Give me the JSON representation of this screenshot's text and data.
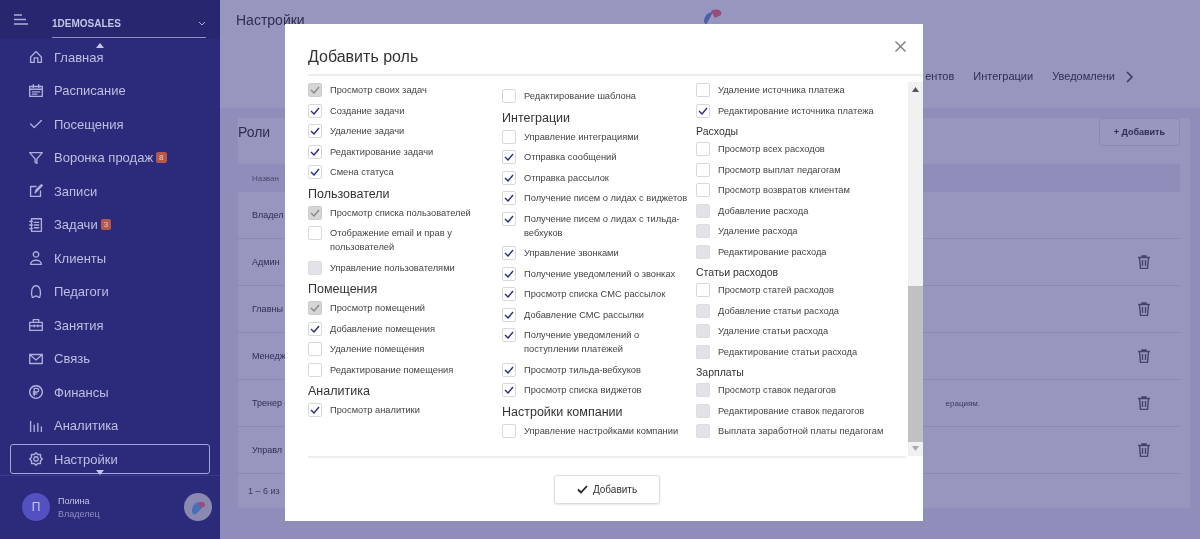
{
  "sidebar": {
    "company": "1DEMOSALES",
    "items": [
      {
        "label": "Главная",
        "selected": false
      },
      {
        "label": "Расписание",
        "selected": false
      },
      {
        "label": "Посещения",
        "selected": false
      },
      {
        "label": "Воронка продаж",
        "selected": false,
        "badge": "8"
      },
      {
        "label": "Записи",
        "selected": false
      },
      {
        "label": "Задачи",
        "selected": false,
        "badge": "3"
      },
      {
        "label": "Клиенты",
        "selected": false
      },
      {
        "label": "Педагоги",
        "selected": false
      },
      {
        "label": "Занятия",
        "selected": false
      },
      {
        "label": "Связь",
        "selected": false
      },
      {
        "label": "Финансы",
        "selected": false
      },
      {
        "label": "Аналитика",
        "selected": false
      },
      {
        "label": "Настройки",
        "selected": true
      }
    ],
    "user": {
      "initial": "П",
      "name": "Полина",
      "role": "Владелец"
    }
  },
  "page": {
    "title": "Настройки",
    "tabs": [
      {
        "label": "ентов",
        "selected": false
      },
      {
        "label": "Интеграции",
        "selected": false
      },
      {
        "label": "Уведомлени",
        "selected": false
      }
    ],
    "section_title": "Роли",
    "add_button": "+ Добавить",
    "table": {
      "columns": [
        "Назван"
      ],
      "rows": [
        {
          "name": "Владел",
          "description": "",
          "deletable": false
        },
        {
          "name": "Админ",
          "description": "",
          "deletable": true
        },
        {
          "name": "Главны",
          "description": "",
          "deletable": true
        },
        {
          "name": "Менедж",
          "description": "",
          "deletable": true
        },
        {
          "name": "Тренер",
          "description": "ерациям.",
          "deletable": true
        },
        {
          "name": "Управл",
          "description": "",
          "deletable": true
        }
      ]
    },
    "pagination": "1 – 6 из"
  },
  "modal": {
    "title": "Добавить роль",
    "columns": [
      [
        {
          "items": [
            {
              "label": "Просмотр своих задач",
              "checked": true,
              "disabled": true
            },
            {
              "label": "Создание задачи",
              "checked": true,
              "disabled": false
            },
            {
              "label": "Удаление задачи",
              "checked": true,
              "disabled": false
            },
            {
              "label": "Редактирование задачи",
              "checked": true,
              "disabled": false
            },
            {
              "label": "Смена статуса",
              "checked": true,
              "disabled": false
            }
          ]
        },
        {
          "heading": "Пользователи",
          "items": [
            {
              "label": "Просмотр списка пользователей",
              "checked": true,
              "disabled": true
            },
            {
              "label": "Отображение email и прав у пользователей",
              "checked": false,
              "disabled": false
            },
            {
              "label": "Управление пользователями",
              "checked": false,
              "disabled": true
            }
          ]
        },
        {
          "heading": "Помещения",
          "items": [
            {
              "label": "Просмотр помещений",
              "checked": true,
              "disabled": true
            },
            {
              "label": "Добавление помещения",
              "checked": true,
              "disabled": false
            },
            {
              "label": "Удаление помещения",
              "checked": false,
              "disabled": false
            },
            {
              "label": "Редактирование помещения",
              "checked": false,
              "disabled": false
            }
          ]
        },
        {
          "heading": "Аналитика",
          "items": [
            {
              "label": "Просмотр аналитики",
              "checked": true,
              "disabled": false
            }
          ]
        }
      ],
      [
        {
          "items": [
            {
              "label": "Редактирование шаблона",
              "checked": false,
              "disabled": false
            }
          ]
        },
        {
          "heading": "Интеграции",
          "items": [
            {
              "label": "Управление интеграциями",
              "checked": false,
              "disabled": false
            },
            {
              "label": "Отправка сообщений",
              "checked": true,
              "disabled": false
            },
            {
              "label": "Отправка рассылок",
              "checked": true,
              "disabled": false
            },
            {
              "label": "Получение писем о лидах с виджетов",
              "checked": true,
              "disabled": false
            },
            {
              "label": "Получение писем о лидах с тильда-вебхуков",
              "checked": true,
              "disabled": false
            },
            {
              "label": "Управление звонками",
              "checked": true,
              "disabled": false
            },
            {
              "label": "Получение уведомлений о звонках",
              "checked": true,
              "disabled": false
            },
            {
              "label": "Просмотр списка СМС рассылок",
              "checked": true,
              "disabled": false
            },
            {
              "label": "Добавление СМС рассылки",
              "checked": true,
              "disabled": false
            },
            {
              "label": "Получение уведомлений о поступлении платежей",
              "checked": true,
              "disabled": false
            },
            {
              "label": "Просмотр тильда-вебхуков",
              "checked": true,
              "disabled": false
            },
            {
              "label": "Просмотр списка виджетов",
              "checked": true,
              "disabled": false
            }
          ]
        },
        {
          "heading": "Настройки компании",
          "items": [
            {
              "label": "Управление настройками компании",
              "checked": false,
              "disabled": false
            }
          ]
        }
      ],
      [
        {
          "items": [
            {
              "label": "Удаление источника платежа",
              "checked": false,
              "disabled": false
            },
            {
              "label": "Редактирование источника платежа",
              "checked": true,
              "disabled": false
            }
          ]
        },
        {
          "heading": "Расходы",
          "items": [
            {
              "label": "Просмотр всех расходов",
              "checked": false,
              "disabled": false
            },
            {
              "label": "Просмотр выплат педагогам",
              "checked": false,
              "disabled": false
            },
            {
              "label": "Просмотр возвратов клиентам",
              "checked": false,
              "disabled": false
            },
            {
              "label": "Добавление расхода",
              "checked": false,
              "disabled": true
            },
            {
              "label": "Удаление расхода",
              "checked": false,
              "disabled": true
            },
            {
              "label": "Редактирование расхода",
              "checked": false,
              "disabled": true
            }
          ]
        },
        {
          "heading": "Статьи расходов",
          "items": [
            {
              "label": "Просмотр статей расходов",
              "checked": false,
              "disabled": false
            },
            {
              "label": "Добавление статьи расхода",
              "checked": false,
              "disabled": true
            },
            {
              "label": "Удаление статьи расхода",
              "checked": false,
              "disabled": true
            },
            {
              "label": "Редактирование статьи расхода",
              "checked": false,
              "disabled": true
            }
          ]
        },
        {
          "heading": "Зарплаты",
          "items": [
            {
              "label": "Просмотр ставок педагогов",
              "checked": false,
              "disabled": true
            },
            {
              "label": "Редактирование ставок педагогов",
              "checked": false,
              "disabled": true
            },
            {
              "label": "Выплата заработной платы педагогам",
              "checked": false,
              "disabled": true
            }
          ]
        }
      ]
    ],
    "submit": "Добавить"
  }
}
